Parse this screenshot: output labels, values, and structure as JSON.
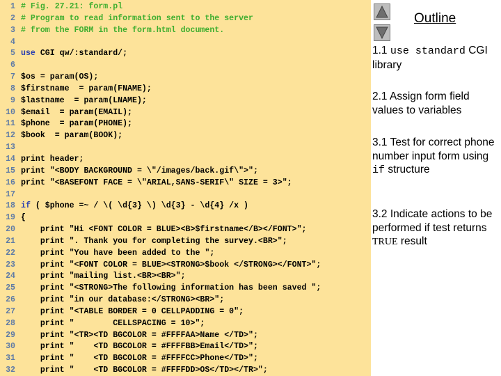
{
  "code": {
    "lines": [
      {
        "n": "1",
        "segments": [
          {
            "t": "# Fig. 27.21: form.pl",
            "k": "comment"
          }
        ]
      },
      {
        "n": "2",
        "segments": [
          {
            "t": "# Program to read information sent to the server",
            "k": "comment"
          }
        ]
      },
      {
        "n": "3",
        "segments": [
          {
            "t": "# from the FORM in the form.html document.",
            "k": "comment"
          }
        ]
      },
      {
        "n": "4",
        "segments": []
      },
      {
        "n": "5",
        "segments": [
          {
            "t": "use",
            "k": "keyword"
          },
          {
            "t": " CGI qw/:standard/;",
            "k": "plain"
          }
        ]
      },
      {
        "n": "6",
        "segments": []
      },
      {
        "n": "7",
        "segments": [
          {
            "t": "$os = param(OS);",
            "k": "plain"
          }
        ]
      },
      {
        "n": "8",
        "segments": [
          {
            "t": "$firstname  = param(FNAME);",
            "k": "plain"
          }
        ]
      },
      {
        "n": "9",
        "segments": [
          {
            "t": "$lastname  = param(LNAME);",
            "k": "plain"
          }
        ]
      },
      {
        "n": "10",
        "segments": [
          {
            "t": "$email  = param(EMAIL);",
            "k": "plain"
          }
        ]
      },
      {
        "n": "11",
        "segments": [
          {
            "t": "$phone  = param(PHONE);",
            "k": "plain"
          }
        ]
      },
      {
        "n": "12",
        "segments": [
          {
            "t": "$book  = param(BOOK);",
            "k": "plain"
          }
        ]
      },
      {
        "n": "13",
        "segments": []
      },
      {
        "n": "14",
        "segments": [
          {
            "t": "print header;",
            "k": "plain"
          }
        ]
      },
      {
        "n": "15",
        "segments": [
          {
            "t": "print \"<BODY BACKGROUND = \\\"/images/back.gif\\\">\";",
            "k": "plain"
          }
        ]
      },
      {
        "n": "16",
        "segments": [
          {
            "t": "print \"<BASEFONT FACE = \\\"ARIAL,SANS-SERIF\\\" SIZE = 3>\";",
            "k": "plain"
          }
        ]
      },
      {
        "n": "17",
        "segments": []
      },
      {
        "n": "18",
        "segments": [
          {
            "t": "if",
            "k": "keyword"
          },
          {
            "t": " ( $phone =~ / \\( \\d{3} \\) \\d{3} - \\d{4} /x )",
            "k": "plain"
          }
        ]
      },
      {
        "n": "19",
        "segments": [
          {
            "t": "{",
            "k": "plain"
          }
        ]
      },
      {
        "n": "20",
        "segments": [
          {
            "t": "    print \"Hi <FONT COLOR = BLUE><B>$firstname</B></FONT>\";",
            "k": "plain"
          }
        ]
      },
      {
        "n": "21",
        "segments": [
          {
            "t": "    print \". Thank you for completing the survey.<BR>\";",
            "k": "plain"
          }
        ]
      },
      {
        "n": "22",
        "segments": [
          {
            "t": "    print \"You have been added to the \";",
            "k": "plain"
          }
        ]
      },
      {
        "n": "23",
        "segments": [
          {
            "t": "    print \"<FONT COLOR = BLUE><STRONG>$book </STRONG></FONT>\";",
            "k": "plain"
          }
        ]
      },
      {
        "n": "24",
        "segments": [
          {
            "t": "    print \"mailing list.<BR><BR>\";",
            "k": "plain"
          }
        ]
      },
      {
        "n": "25",
        "segments": [
          {
            "t": "    print \"<STRONG>The following information has been saved \";",
            "k": "plain"
          }
        ]
      },
      {
        "n": "26",
        "segments": [
          {
            "t": "    print \"in our database:</STRONG><BR>\";",
            "k": "plain"
          }
        ]
      },
      {
        "n": "27",
        "segments": [
          {
            "t": "    print \"<TABLE BORDER = 0 CELLPADDING = 0\";",
            "k": "plain"
          }
        ]
      },
      {
        "n": "28",
        "segments": [
          {
            "t": "    print \"        CELLSPACING = 10>\";",
            "k": "plain"
          }
        ]
      },
      {
        "n": "29",
        "segments": [
          {
            "t": "    print \"<TR><TD BGCOLOR = #FFFFAA>Name </TD>\";",
            "k": "plain"
          }
        ]
      },
      {
        "n": "30",
        "segments": [
          {
            "t": "    print \"    <TD BGCOLOR = #FFFFBB>Email</TD>\";",
            "k": "plain"
          }
        ]
      },
      {
        "n": "31",
        "segments": [
          {
            "t": "    print \"    <TD BGCOLOR = #FFFFCC>Phone</TD>\";",
            "k": "plain"
          }
        ]
      },
      {
        "n": "32",
        "segments": [
          {
            "t": "    print \"    <TD BGCOLOR = #FFFFDD>OS</TD></TR>\";",
            "k": "plain"
          }
        ]
      }
    ]
  },
  "outline": {
    "title": "Outline",
    "up_icon": "triangle-up-icon",
    "down_icon": "triangle-down-icon",
    "items": [
      {
        "segments": [
          {
            "t": "1.1 ",
            "k": "text"
          },
          {
            "t": "use standard",
            "k": "mono"
          },
          {
            "t": " CGI library",
            "k": "text"
          }
        ]
      },
      {
        "segments": [
          {
            "t": "2.1 Assign form field values to variables",
            "k": "text"
          }
        ]
      },
      {
        "segments": [
          {
            "t": "3.1 Test for correct phone number input form using ",
            "k": "text"
          },
          {
            "t": "if",
            "k": "mono"
          },
          {
            "t": " structure",
            "k": "text"
          }
        ]
      },
      {
        "segments": [
          {
            "t": "3.2 Indicate actions to be performed if test returns ",
            "k": "text"
          },
          {
            "t": "TRUE",
            "k": "serif-caps"
          },
          {
            "t": " result",
            "k": "text"
          }
        ]
      }
    ]
  },
  "colors": {
    "code_background": "#fde39a",
    "comment": "#3fae2f",
    "keyword": "#2a3fb0",
    "line_number": "#5d7aa6"
  }
}
